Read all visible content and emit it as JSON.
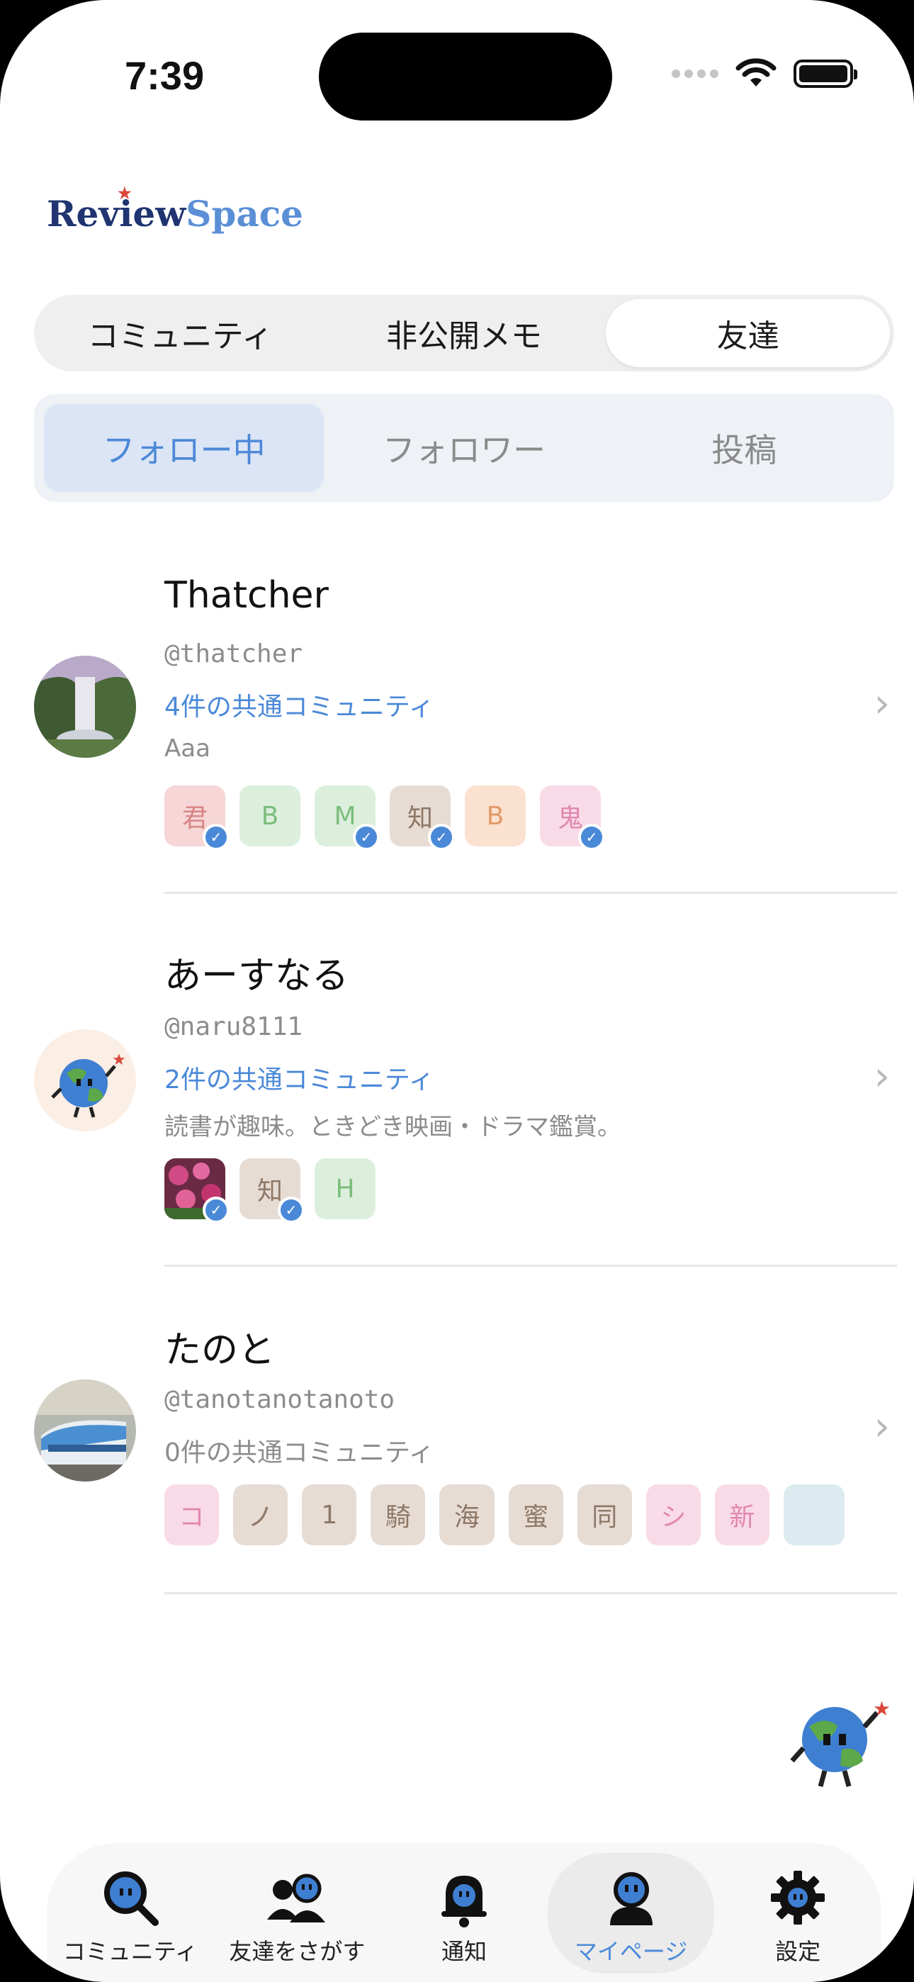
{
  "status": {
    "time": "7:39"
  },
  "brand": {
    "review": "Review",
    "space": "Space"
  },
  "top_segment": [
    {
      "label": "コミュニティ",
      "active": false
    },
    {
      "label": "非公開メモ",
      "active": false
    },
    {
      "label": "友達",
      "active": true
    }
  ],
  "sub_segment": [
    {
      "label": "フォロー中",
      "active": true
    },
    {
      "label": "フォロワー",
      "active": false
    },
    {
      "label": "投稿",
      "active": false
    }
  ],
  "users": [
    {
      "name": "Thatcher",
      "handle": "@thatcher",
      "common": "4件の共通コミュニティ",
      "bio": "Aaa",
      "avatar": "waterfall-photo",
      "badges": [
        {
          "text": "君",
          "color": "red",
          "verified": true
        },
        {
          "text": "B",
          "color": "green",
          "verified": false
        },
        {
          "text": "M",
          "color": "green",
          "verified": true
        },
        {
          "text": "知",
          "color": "brown",
          "verified": true
        },
        {
          "text": "B",
          "color": "orange",
          "verified": false
        },
        {
          "text": "鬼",
          "color": "pink",
          "verified": true
        }
      ]
    },
    {
      "name": "あーすなる",
      "handle": "@naru8111",
      "common": "2件の共通コミュニティ",
      "bio": "読書が趣味。ときどき映画・ドラマ鑑賞。",
      "avatar": "earth-mascot",
      "badges": [
        {
          "text": "",
          "color": "photo",
          "verified": true
        },
        {
          "text": "知",
          "color": "brown",
          "verified": true
        },
        {
          "text": "H",
          "color": "green",
          "verified": false
        }
      ]
    },
    {
      "name": "たのと",
      "handle": "@tanotanotanoto",
      "common": "0件の共通コミュニティ",
      "bio": "",
      "avatar": "train-photo",
      "badges": [
        {
          "text": "コ",
          "color": "pink",
          "verified": false
        },
        {
          "text": "ノ",
          "color": "brown",
          "verified": false
        },
        {
          "text": "1",
          "color": "brown",
          "verified": false
        },
        {
          "text": "騎",
          "color": "brown",
          "verified": false
        },
        {
          "text": "海",
          "color": "brown",
          "verified": false
        },
        {
          "text": "蜜",
          "color": "brown",
          "verified": false
        },
        {
          "text": "同",
          "color": "brown",
          "verified": false
        },
        {
          "text": "シ",
          "color": "pink",
          "verified": false
        },
        {
          "text": "新",
          "color": "pink",
          "verified": false
        }
      ]
    }
  ],
  "tabbar": [
    {
      "label": "コミュニティ",
      "icon": "search-mascot-icon",
      "active": false
    },
    {
      "label": "友達をさがす",
      "icon": "friends-icon",
      "active": false
    },
    {
      "label": "通知",
      "icon": "bell-icon",
      "active": false
    },
    {
      "label": "マイページ",
      "icon": "mypage-icon",
      "active": true
    },
    {
      "label": "設定",
      "icon": "gear-icon",
      "active": false
    }
  ]
}
